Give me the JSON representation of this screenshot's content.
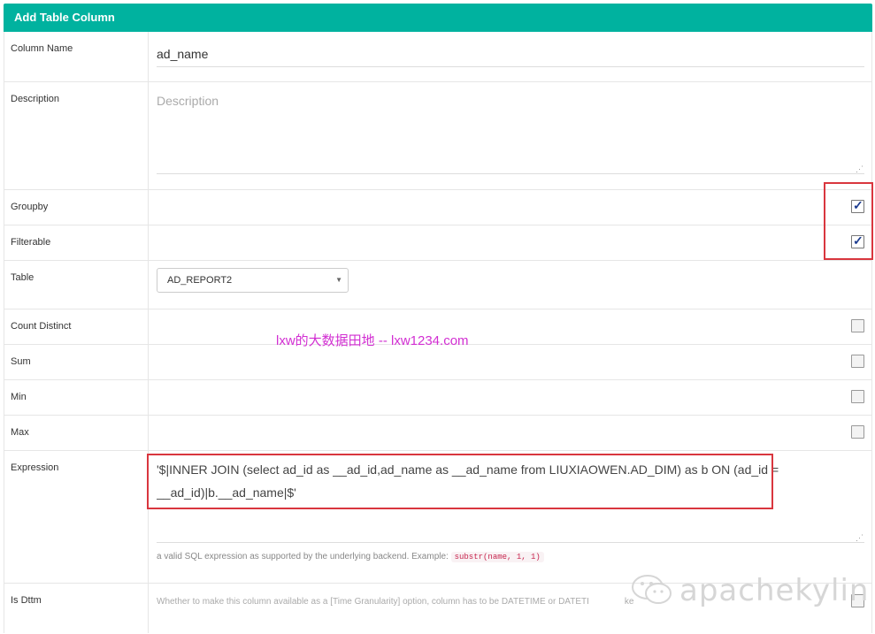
{
  "dialog": {
    "title": "Add Table Column"
  },
  "fields": {
    "column_name": {
      "label": "Column Name",
      "value": "ad_name"
    },
    "description": {
      "label": "Description",
      "placeholder": "Description",
      "value": ""
    },
    "groupby": {
      "label": "Groupby",
      "checked": true
    },
    "filterable": {
      "label": "Filterable",
      "checked": true
    },
    "table": {
      "label": "Table",
      "selected": "AD_REPORT2"
    },
    "count_distinct": {
      "label": "Count Distinct",
      "checked": false
    },
    "sum": {
      "label": "Sum",
      "checked": false
    },
    "min": {
      "label": "Min",
      "checked": false
    },
    "max": {
      "label": "Max",
      "checked": false
    },
    "expression": {
      "label": "Expression",
      "value": "'$|INNER JOIN (select ad_id as __ad_id,ad_name as __ad_name from LIUXIAOWEN.AD_DIM) as b ON (ad_id = __ad_id)|b.__ad_name|$'",
      "help_text": "a valid SQL expression as supported by the underlying backend. Example:",
      "help_code": "substr(name, 1, 1)"
    },
    "is_dttm": {
      "label": "Is Dttm",
      "help_text": "Whether to make this column available as a [Time Granularity] option, column has to be DATETIME or DATETI",
      "help_tail": "ke",
      "checked": false
    }
  },
  "watermark": {
    "text": "lxw的大数据田地 -- lxw1234.com",
    "logo_text": "apachekylin"
  },
  "colors": {
    "header": "#00b29f",
    "highlight": "#d9363e",
    "watermark": "#d22fd2"
  }
}
